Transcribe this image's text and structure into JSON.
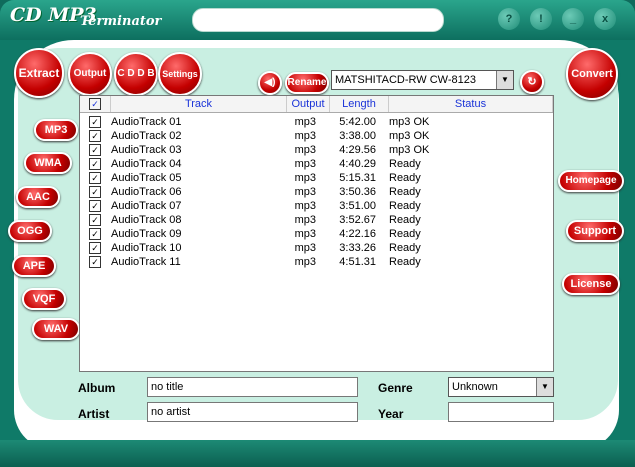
{
  "app": {
    "title": "CD MP3",
    "subtitle": "Terminator"
  },
  "window_buttons": [
    "?",
    "!",
    "_",
    "x"
  ],
  "top_tabs": [
    {
      "label": "Extract"
    },
    {
      "label": "Output"
    },
    {
      "label": "C D D B"
    },
    {
      "label": "Settings"
    }
  ],
  "convert_label": "Convert",
  "rename_label": "Rename",
  "drive": {
    "selected": "MATSHITACD-RW  CW-8123"
  },
  "side_formats": [
    "MP3",
    "WMA",
    "AAC",
    "OGG",
    "APE",
    "VQF",
    "WAV"
  ],
  "side_links": [
    "Homepage",
    "Support",
    "License"
  ],
  "table": {
    "headers": {
      "check": "✓",
      "track": "Track",
      "output": "Output",
      "length": "Length",
      "status": "Status"
    },
    "rows": [
      {
        "track": "AudioTrack 01",
        "output": "mp3",
        "length": "5:42.00",
        "status": "mp3 OK"
      },
      {
        "track": "AudioTrack 02",
        "output": "mp3",
        "length": "3:38.00",
        "status": "mp3 OK"
      },
      {
        "track": "AudioTrack 03",
        "output": "mp3",
        "length": "4:29.56",
        "status": "mp3 OK"
      },
      {
        "track": "AudioTrack 04",
        "output": "mp3",
        "length": "4:40.29",
        "status": "Ready"
      },
      {
        "track": "AudioTrack 05",
        "output": "mp3",
        "length": "5:15.31",
        "status": "Ready"
      },
      {
        "track": "AudioTrack 06",
        "output": "mp3",
        "length": "3:50.36",
        "status": "Ready"
      },
      {
        "track": "AudioTrack 07",
        "output": "mp3",
        "length": "3:51.00",
        "status": "Ready"
      },
      {
        "track": "AudioTrack 08",
        "output": "mp3",
        "length": "3:52.67",
        "status": "Ready"
      },
      {
        "track": "AudioTrack 09",
        "output": "mp3",
        "length": "4:22.16",
        "status": "Ready"
      },
      {
        "track": "AudioTrack 10",
        "output": "mp3",
        "length": "3:33.26",
        "status": "Ready"
      },
      {
        "track": "AudioTrack 11",
        "output": "mp3",
        "length": "4:51.31",
        "status": "Ready"
      }
    ]
  },
  "fields": {
    "album_label": "Album",
    "album_value": "no title",
    "artist_label": "Artist",
    "artist_value": "no artist",
    "genre_label": "Genre",
    "genre_value": "Unknown",
    "year_label": "Year",
    "year_value": ""
  }
}
